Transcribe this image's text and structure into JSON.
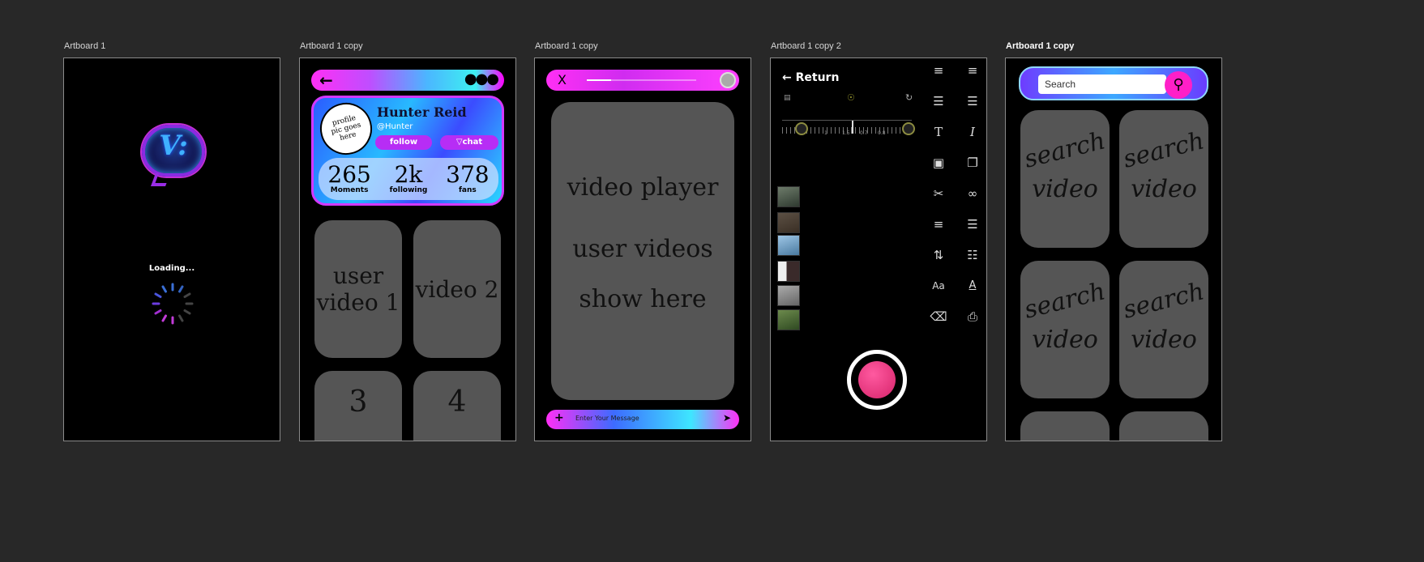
{
  "artboards": [
    {
      "label": "Artboard 1"
    },
    {
      "label": "Artboard 1 copy"
    },
    {
      "label": "Artboard 1 copy"
    },
    {
      "label": "Artboard 1 copy 2"
    },
    {
      "label": "Artboard 1 copy"
    }
  ],
  "loading": {
    "logo_glyph": "V:",
    "text": "Loading..."
  },
  "profile": {
    "back_icon": "arrow-left-icon",
    "more_icon": "more-dots-icon",
    "avatar_text": "profile pic goes here",
    "name": "Hunter Reid",
    "handle": "@Hunter",
    "follow_label": "follow",
    "chat_label": "chat",
    "stats": [
      {
        "num": "265",
        "label": "Moments"
      },
      {
        "num": "2k",
        "label": "following"
      },
      {
        "num": "378",
        "label": "fans"
      }
    ],
    "videos": [
      "user video 1",
      "video 2",
      "3",
      "4"
    ]
  },
  "player": {
    "close_label": "X",
    "progress": 0.22,
    "lines": [
      "video player",
      "user videos",
      "show here"
    ],
    "message_placeholder": "Enter Your Message",
    "plus_label": "+",
    "send_icon": "send-icon"
  },
  "camera": {
    "return_label": "Return",
    "ruler_numbers": [
      "0.5",
      "1",
      "1.5",
      "0.7",
      "0.8",
      "0.9",
      "1"
    ],
    "thumbnails": 6,
    "tools_left": [
      "align-justify-icon",
      "list-ordered-icon",
      "text-size-icon",
      "save-icon",
      "cut-icon",
      "align-right-icon",
      "line-spacing-icon",
      "font-icon",
      "eraser-icon"
    ],
    "tools_right": [
      "align-left-icon",
      "list-indent-icon",
      "italic-icon",
      "copy-icon",
      "link-icon",
      "bullet-list-icon",
      "columns-icon",
      "underline-icon",
      "print-icon"
    ],
    "tool_text_aa": "Aa",
    "tool_text_a": "A",
    "tool_text_i": "I",
    "tool_text_t": "T"
  },
  "search": {
    "placeholder": "Search",
    "tile_text_1": "search",
    "tile_text_2": "video"
  }
}
